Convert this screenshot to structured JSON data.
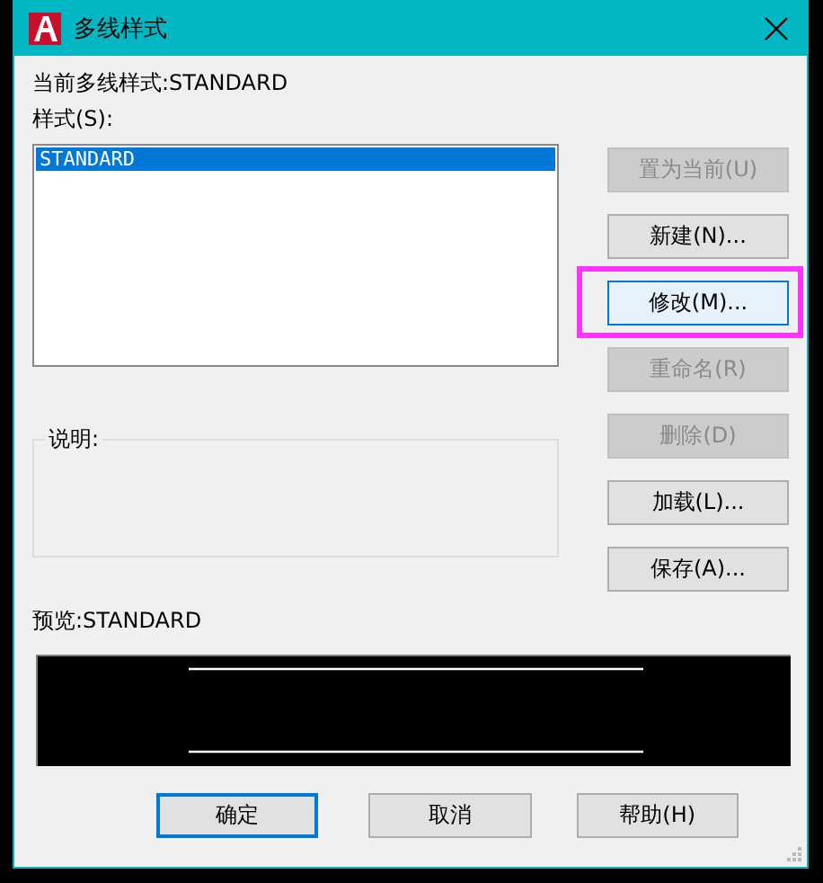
{
  "window": {
    "title": "多线样式"
  },
  "current_style": {
    "label": "当前多线样式:STANDARD"
  },
  "styles": {
    "label": "样式(S):",
    "items": [
      {
        "text": "STANDARD",
        "selected": true
      }
    ]
  },
  "side_buttons": [
    {
      "label": "置为当前(U)",
      "disabled": true,
      "focused": false,
      "highlighted": false
    },
    {
      "label": "新建(N)...",
      "disabled": false,
      "focused": false,
      "highlighted": false
    },
    {
      "label": "修改(M)...",
      "disabled": false,
      "focused": true,
      "highlighted": true
    },
    {
      "label": "重命名(R)",
      "disabled": true,
      "focused": false,
      "highlighted": false
    },
    {
      "label": "删除(D)",
      "disabled": true,
      "focused": false,
      "highlighted": false
    },
    {
      "label": "加载(L)...",
      "disabled": false,
      "focused": false,
      "highlighted": false
    },
    {
      "label": "保存(A)...",
      "disabled": false,
      "focused": false,
      "highlighted": false
    }
  ],
  "description": {
    "label": "说明:"
  },
  "preview": {
    "label": "预览:STANDARD"
  },
  "bottom_buttons": [
    {
      "label": "确定",
      "focused": true
    },
    {
      "label": "取消",
      "focused": false
    },
    {
      "label": "帮助(H)",
      "focused": false
    }
  ]
}
